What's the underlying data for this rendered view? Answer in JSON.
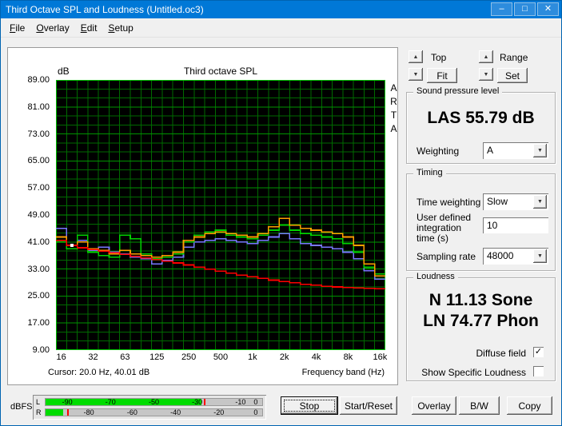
{
  "window": {
    "title": "Third Octave SPL and Loudness (Untitled.oc3)",
    "minimize_glyph": "–",
    "maximize_glyph": "□",
    "close_glyph": "✕"
  },
  "menu": {
    "items": [
      {
        "label": "File"
      },
      {
        "label": "Overlay"
      },
      {
        "label": "Edit"
      },
      {
        "label": "Setup"
      }
    ]
  },
  "chart_data": {
    "type": "line",
    "title": "Third octave SPL",
    "ylabel": "dB",
    "xlabel": "Frequency band (Hz)",
    "cursor_text": "Cursor:   20.0 Hz, 40.01 dB",
    "watermark": "ARTA",
    "ylim": [
      9,
      89
    ],
    "ygrid_minor": 2.6667,
    "ygrid_major": 8,
    "yticks": [
      "89.00",
      "81.00",
      "73.00",
      "65.00",
      "57.00",
      "49.00",
      "41.00",
      "33.00",
      "25.00",
      "17.00",
      "9.00"
    ],
    "xticks": [
      "16",
      "32",
      "63",
      "125",
      "250",
      "500",
      "1k",
      "2k",
      "4k",
      "8k",
      "16k"
    ],
    "xtick_idx": [
      0,
      3,
      6,
      9,
      12,
      15,
      18,
      21,
      24,
      27,
      30
    ],
    "bands": [
      16,
      20,
      25,
      31.5,
      40,
      50,
      63,
      80,
      100,
      125,
      160,
      200,
      250,
      315,
      400,
      500,
      630,
      800,
      1000,
      1250,
      1600,
      2000,
      2500,
      3150,
      4000,
      5000,
      6300,
      8000,
      10000,
      12500,
      16000
    ],
    "cursor_point": {
      "band_index": 1,
      "db": 40.01
    },
    "colors": {
      "background": "#000000",
      "grid": "#006a00",
      "grid_major": "#009300",
      "frame": "#00c000"
    },
    "series": [
      {
        "name": "blue",
        "color": "#7878ff",
        "values": [
          45,
          40,
          41.5,
          38.5,
          39.5,
          38,
          37.5,
          36.5,
          36,
          34.5,
          35.5,
          36.5,
          39.5,
          41,
          41.5,
          42,
          41.5,
          41,
          40.5,
          41.5,
          42.5,
          43.5,
          42,
          40.5,
          40,
          39.5,
          39,
          38,
          36,
          32.5,
          30
        ]
      },
      {
        "name": "green",
        "color": "#00d200",
        "values": [
          41,
          39,
          43,
          38,
          37,
          36.5,
          43,
          42,
          37.5,
          36,
          36.5,
          37.5,
          41,
          43,
          44,
          44.5,
          43,
          42.5,
          42,
          43,
          44.5,
          46,
          44.5,
          43.5,
          43,
          42.5,
          42,
          40.5,
          38,
          33.5,
          31.5
        ]
      },
      {
        "name": "orange",
        "color": "#ffa000",
        "values": [
          42.5,
          40,
          41,
          39,
          38.5,
          37.5,
          38.5,
          37.5,
          37,
          36.5,
          37,
          38,
          41.5,
          42.5,
          43.5,
          44,
          43.5,
          43,
          42.5,
          43.5,
          45.5,
          48,
          46,
          45,
          44.5,
          44,
          43.5,
          42.5,
          40,
          34.5,
          31
        ]
      },
      {
        "name": "red",
        "color": "#ff0000",
        "values": [
          41.5,
          40,
          39.3,
          38.8,
          38.3,
          37.8,
          37.3,
          36.8,
          36.3,
          35.8,
          35.3,
          34.8,
          34.2,
          33.6,
          33,
          32.4,
          31.8,
          31.2,
          30.7,
          30.2,
          29.7,
          29.3,
          28.9,
          28.5,
          28.2,
          27.9,
          27.7,
          27.5,
          27.4,
          27.3,
          27.2
        ]
      }
    ]
  },
  "right_panel": {
    "top_label": "Top",
    "fit_label": "Fit",
    "range_label": "Range",
    "set_label": "Set",
    "spl_group": {
      "title": "Sound pressure level",
      "value": "LAS 55.79 dB",
      "weighting_label": "Weighting",
      "weighting_value": "A"
    },
    "timing_group": {
      "title": "Timing",
      "time_weighting_label": "Time weighting",
      "time_weighting_value": "Slow",
      "integration_label": "User defined integration time (s)",
      "integration_value": "10",
      "sampling_label": "Sampling rate",
      "sampling_value": "48000"
    },
    "loudness_group": {
      "title": "Loudness",
      "sone_value": "N 11.13 Sone",
      "phon_value": "LN 74.77 Phon",
      "diffuse_label": "Diffuse field",
      "diffuse_checked": true,
      "specific_label": "Show Specific Loudness",
      "specific_checked": false
    }
  },
  "bottom_bar": {
    "dbfs_label": "dBFS",
    "meter": {
      "rows": [
        {
          "label": "L",
          "level_pct": 72,
          "peak_pct": 73,
          "ticks": [
            {
              "t": "-90",
              "pct": 10
            },
            {
              "t": "-70",
              "pct": 30
            },
            {
              "t": "-50",
              "pct": 50
            },
            {
              "t": "-30",
              "pct": 70
            },
            {
              "t": "-10",
              "pct": 90
            },
            {
              "t": "0",
              "pct": 97
            }
          ]
        },
        {
          "label": "R",
          "level_pct": 8,
          "peak_pct": 10,
          "ticks": [
            {
              "t": "-80",
              "pct": 20
            },
            {
              "t": "-60",
              "pct": 40
            },
            {
              "t": "-40",
              "pct": 60
            },
            {
              "t": "-20",
              "pct": 80
            },
            {
              "t": "0",
              "pct": 97
            }
          ]
        }
      ]
    },
    "stop_label": "Stop",
    "start_label": "Start/Reset",
    "overlay_label": "Overlay",
    "bw_label": "B/W",
    "copy_label": "Copy"
  },
  "icons": {
    "spin_up": "▲",
    "spin_down": "▼",
    "combo_arrow": "▼",
    "check": "✓"
  }
}
